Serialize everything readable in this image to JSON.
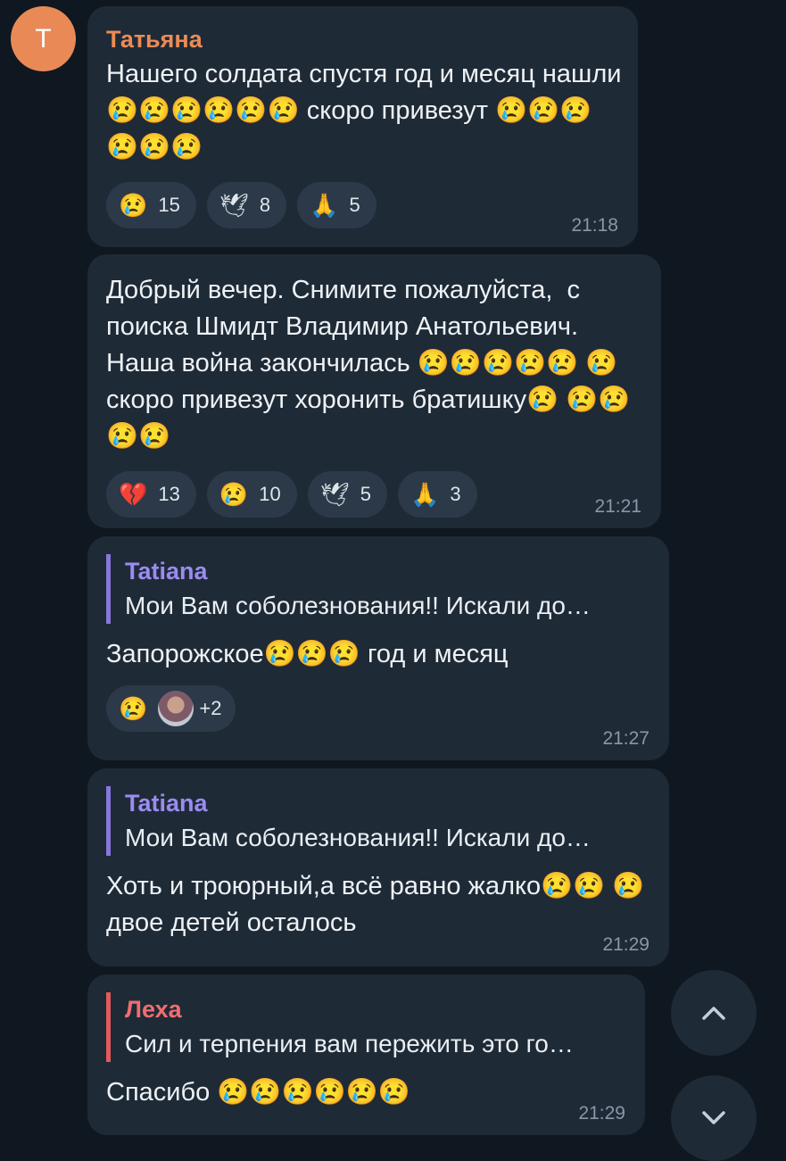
{
  "avatar_letter": "T",
  "messages": [
    {
      "sender": "Татьяна",
      "text": "Нашего солдата спустя год и месяц нашли 😢😢😢😢😢😢 скоро привезут 😢😢😢😢😢😢",
      "reactions": [
        {
          "emoji": "😢",
          "count": "15"
        },
        {
          "emoji": "🕊",
          "count": "8"
        },
        {
          "emoji": "🙏",
          "count": "5"
        }
      ],
      "time": "21:18"
    },
    {
      "text": "Добрый вечер. Снимите пожалуйста,  с поиска Шмидт Владимир Анатольевич. Наша война закончилась 😢😢😢😢😢 😢 скоро привезут хоронить братишку😢 😢😢😢😢",
      "reactions": [
        {
          "emoji": "💔",
          "count": "13"
        },
        {
          "emoji": "😢",
          "count": "10"
        },
        {
          "emoji": "🕊",
          "count": "5"
        },
        {
          "emoji": "🙏",
          "count": "3"
        }
      ],
      "time": "21:21"
    },
    {
      "quote_name": "Tatiana",
      "quote_text": "Мои Вам соболезнования!! Искали до…",
      "text": "Запорожское😢😢😢 год и месяц",
      "reaction_emoji": "😢",
      "reaction_extra": "+2",
      "time": "21:27"
    },
    {
      "quote_name": "Tatiana",
      "quote_text": "Мои Вам соболезнования!! Искали до…",
      "text": "Хоть и троюрный,а всё равно жалко😢😢 😢 двое детей осталось",
      "time": "21:29"
    },
    {
      "quote_name": "Леха",
      "quote_text": "Сил и терпения вам пережить это го…",
      "text": "Спасибо 😢😢😢😢😢😢",
      "time": "21:29"
    }
  ],
  "scroll_up_icon": "chevron-up-icon",
  "scroll_down_icon": "chevron-down-icon"
}
